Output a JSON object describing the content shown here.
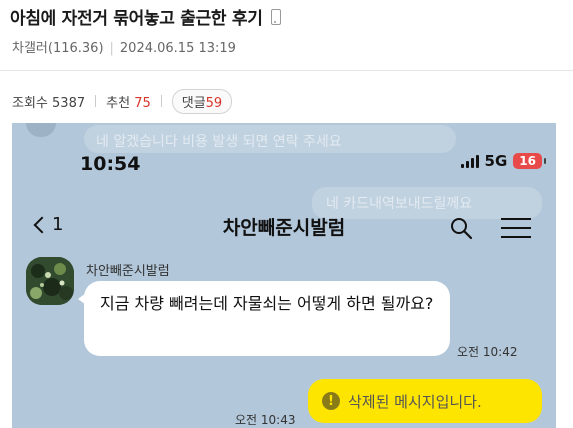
{
  "post": {
    "title": "아침에 자전거 묶어놓고 출근한 후기",
    "author": "차갤러(116.36)",
    "date": "2024.06.15 13:19",
    "views_label": "조회수",
    "views": "5387",
    "likes_label": "추천",
    "likes": "75",
    "comments_label": "댓글",
    "comments": "59"
  },
  "chat": {
    "ghost_text_1": "네 알겠습니다 비용 발생 되면 연락 주세요",
    "ghost_text_2": "네 카드내역보내드릴께요",
    "status_time": "10:54",
    "network": "5G",
    "battery": "16",
    "back_count": "1",
    "room_title": "차안빼준시발럼",
    "sender_name": "차안빼준시발럼",
    "incoming_message": "지금 차량 빼려는데 자물쇠는 어떻게 하면 될까요?",
    "incoming_time": "오전 10:42",
    "outgoing_message": "삭제된 메시지입니다.",
    "outgoing_time": "오전 10:43"
  },
  "colors": {
    "chat_bg": "#b2c7da",
    "my_bubble": "#fee500",
    "accent_red": "#d9342b",
    "battery_red": "#e84a4a"
  },
  "icons": [
    "phone-icon",
    "signal-icon",
    "battery-icon",
    "back-chevron-icon",
    "search-icon",
    "menu-icon",
    "avatar",
    "warning-icon"
  ]
}
